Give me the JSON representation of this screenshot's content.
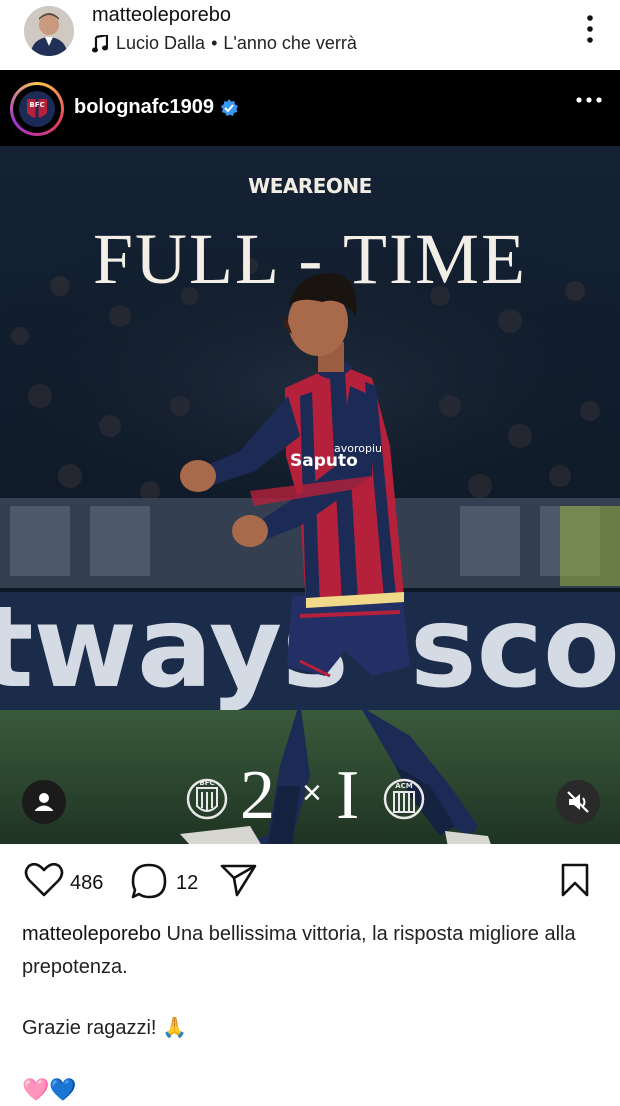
{
  "post": {
    "username": "matteoleporebo",
    "music_artist": "Lucio Dalla",
    "music_separator": "•",
    "music_title": "L'anno che verrà",
    "more_icon": "more-vertical-icon"
  },
  "media": {
    "account": "bolognafc1909",
    "verified_icon": "verified-badge-icon",
    "tagline": "WEAREONE",
    "headline": "FULL - TIME",
    "score_home": "2",
    "score_sep": "×",
    "score_away": "I",
    "home_badge_text": "BFC",
    "away_badge_text": "ACM",
    "sponsor_chest": "Saputo",
    "sponsor_sleeve": "avoropiu",
    "colors": {
      "blue": "#1c2a56",
      "red": "#b5203a",
      "turf": "#2c4a2e"
    }
  },
  "actions": {
    "likes": "486",
    "comments": "12",
    "like_icon": "heart-icon",
    "comment_icon": "comment-icon",
    "share_icon": "send-icon",
    "save_icon": "bookmark-icon"
  },
  "caption": {
    "username": "matteoleporebo",
    "text": "Una bellissima vittoria, la risposta migliore alla prepotenza.",
    "line2": "Grazie ragazzi! 🙏",
    "line3": "🩷💙"
  }
}
